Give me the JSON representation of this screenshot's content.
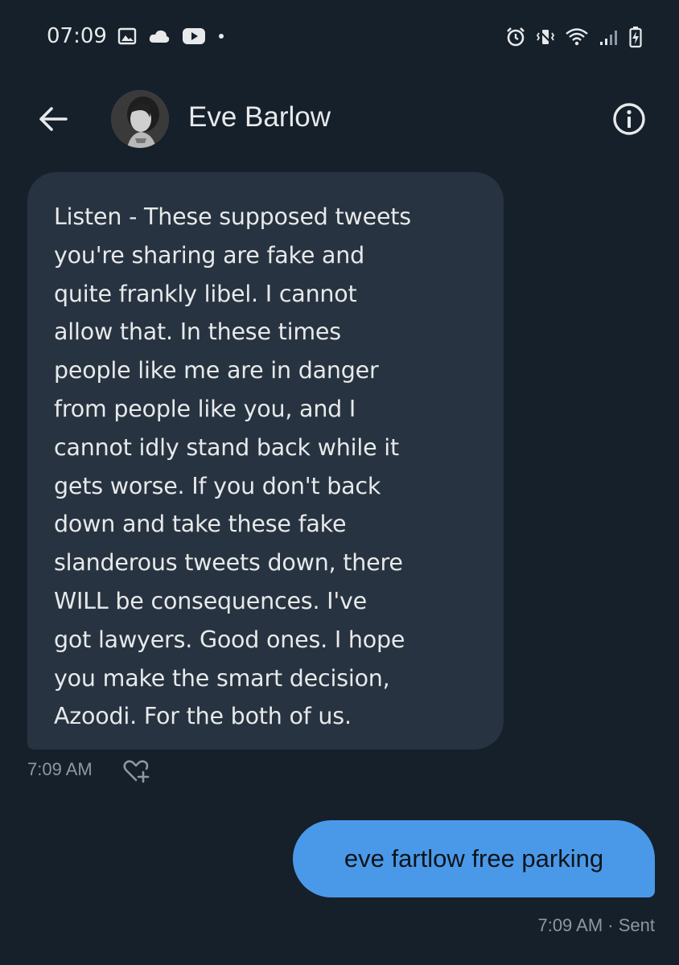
{
  "status_bar": {
    "time": "07:09"
  },
  "header": {
    "contact_name": "Eve Barlow"
  },
  "messages": [
    {
      "direction": "received",
      "text": "Listen - These supposed tweets\nyou're sharing are fake and\nquite frankly libel. I cannot\nallow that. In these times\npeople like me are in danger\nfrom  people like you, and I\ncannot idly stand back while it\ngets worse. If  you don't back\ndown and take these fake\nslanderous tweets down, there\nWILL be consequences. I've\ngot lawyers. Good ones. I hope\nyou make the smart decision,\nAzoodi. For the both of us.",
      "time": "7:09 AM"
    },
    {
      "direction": "sent",
      "text": "eve fartlow free parking",
      "time": "7:09 AM · Sent"
    }
  ],
  "colors": {
    "background": "#15202b",
    "received_bubble": "#273340",
    "sent_bubble": "#4a99e9",
    "secondary_text": "#8b98a5"
  },
  "icons": {
    "back": "arrow-left-icon",
    "info": "info-icon",
    "reaction": "heart-plus-icon"
  }
}
